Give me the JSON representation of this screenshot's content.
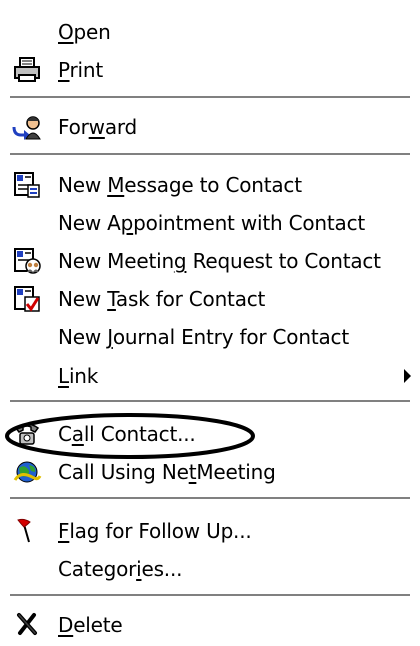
{
  "menu": {
    "items": [
      {
        "label": "Open",
        "mnemonic": "O",
        "icon": "none"
      },
      {
        "label": "Print",
        "mnemonic": "P",
        "icon": "printer-icon"
      },
      {
        "label": "Forward",
        "mnemonic": "w",
        "icon": "forward-contact-icon"
      },
      {
        "label": "New Message to Contact",
        "mnemonic": "M",
        "icon": "new-message-icon"
      },
      {
        "label": "New Appointment with Contact",
        "mnemonic": "p",
        "icon": "none"
      },
      {
        "label": "New Meeting Request to Contact",
        "mnemonic": "g",
        "icon": "meeting-request-icon"
      },
      {
        "label": "New Task for Contact",
        "mnemonic": "T",
        "icon": "task-icon"
      },
      {
        "label": "New Journal Entry for Contact",
        "mnemonic": "J",
        "icon": "none"
      },
      {
        "label": "Link",
        "mnemonic": "L",
        "icon": "none",
        "has_submenu": true
      },
      {
        "label": "Call Contact...",
        "mnemonic": "a",
        "icon": "telephone-icon",
        "highlighted": true
      },
      {
        "label": "Call Using NetMeeting",
        "mnemonic": "t",
        "icon": "netmeeting-icon"
      },
      {
        "label": "Flag for Follow Up...",
        "mnemonic": "F",
        "icon": "flag-icon"
      },
      {
        "label": "Categories...",
        "mnemonic": "i",
        "icon": "none"
      },
      {
        "label": "Delete",
        "mnemonic": "D",
        "icon": "delete-icon"
      }
    ]
  },
  "colors": {
    "separator": "#808080",
    "flag": "#d40000",
    "highlight_ellipse": "#000000"
  }
}
